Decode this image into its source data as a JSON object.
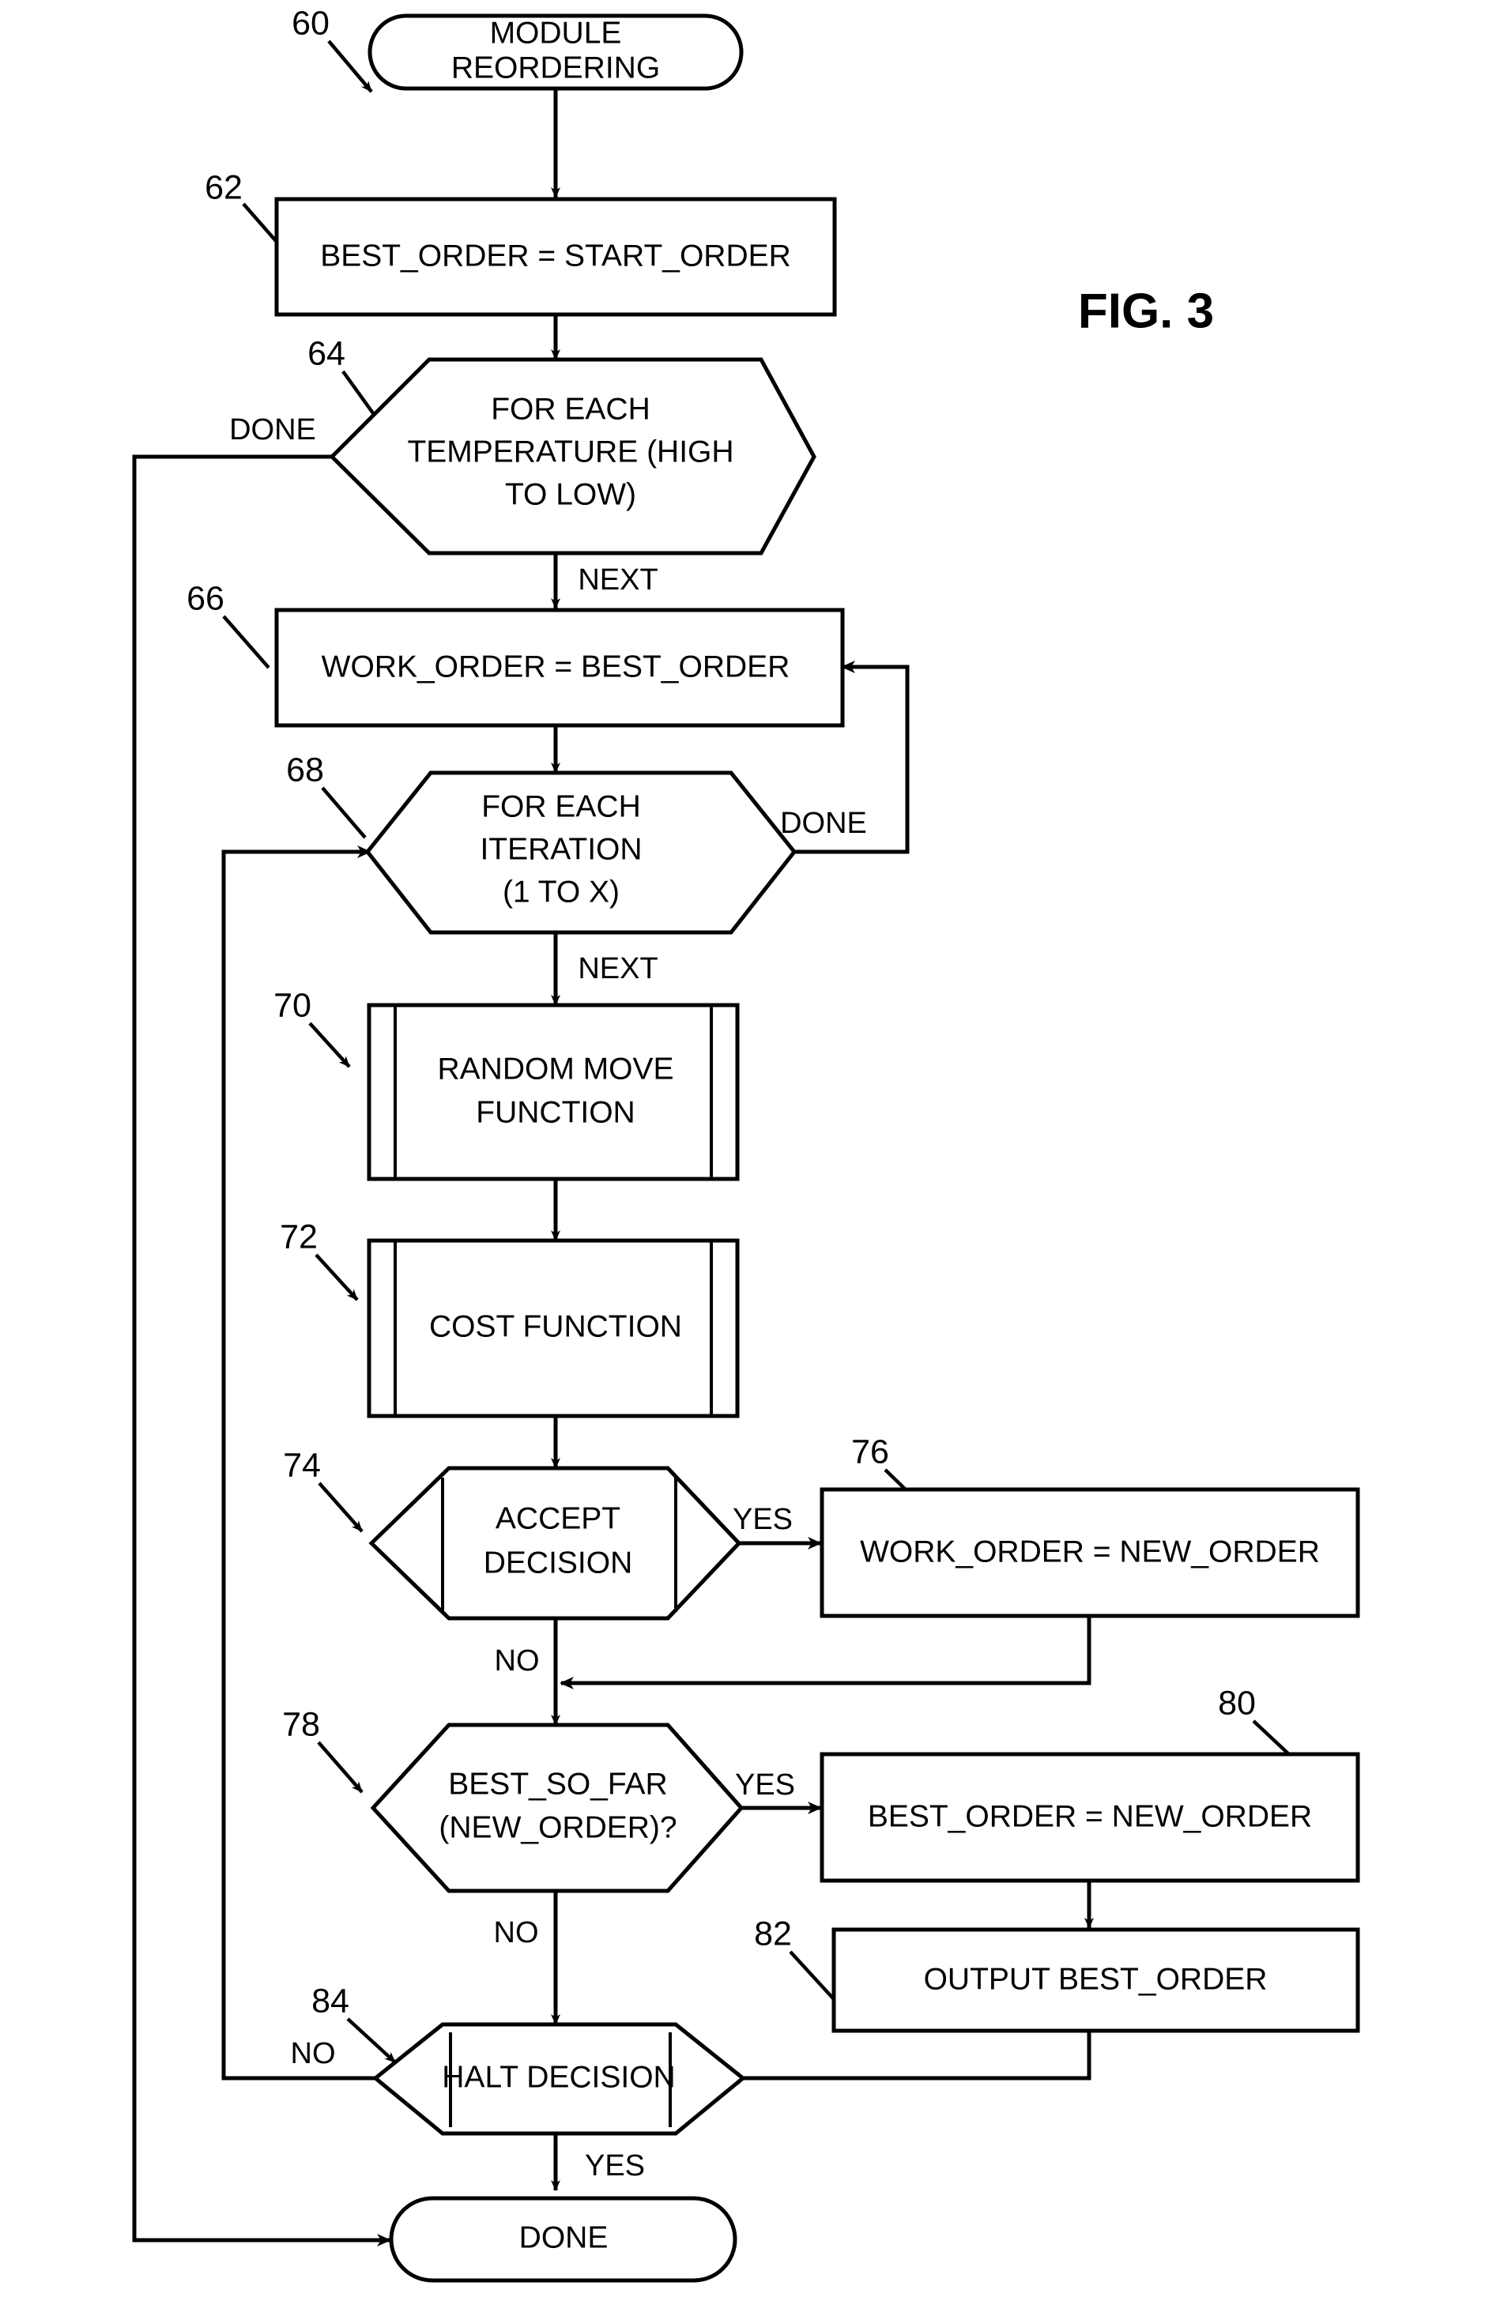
{
  "figure": {
    "label": "FIG. 3",
    "title": "MODULE REORDERING"
  },
  "nodes": [
    {
      "id": "n60",
      "ref": "60",
      "shape": "terminator",
      "lines": [
        "MODULE",
        "REORDERING"
      ]
    },
    {
      "id": "n62",
      "ref": "62",
      "shape": "process",
      "lines": [
        "BEST_ORDER = START_ORDER"
      ]
    },
    {
      "id": "n64",
      "ref": "64",
      "shape": "hexagon",
      "lines": [
        "FOR EACH",
        "TEMPERATURE (HIGH",
        "TO LOW)"
      ]
    },
    {
      "id": "n66",
      "ref": "66",
      "shape": "process",
      "lines": [
        "WORK_ORDER = BEST_ORDER"
      ]
    },
    {
      "id": "n68",
      "ref": "68",
      "shape": "hexagon",
      "lines": [
        "FOR EACH",
        "ITERATION",
        "(1 TO X)"
      ]
    },
    {
      "id": "n70",
      "ref": "70",
      "shape": "subroutine",
      "lines": [
        "RANDOM MOVE",
        "FUNCTION"
      ]
    },
    {
      "id": "n72",
      "ref": "72",
      "shape": "subroutine",
      "lines": [
        "COST FUNCTION"
      ]
    },
    {
      "id": "n74",
      "ref": "74",
      "shape": "hexagon-bars",
      "lines": [
        "ACCEPT",
        "DECISION"
      ]
    },
    {
      "id": "n76",
      "ref": "76",
      "shape": "process",
      "lines": [
        "WORK_ORDER = NEW_ORDER"
      ]
    },
    {
      "id": "n78",
      "ref": "78",
      "shape": "hexagon",
      "lines": [
        "BEST_SO_FAR",
        "(NEW_ORDER)?"
      ]
    },
    {
      "id": "n80",
      "ref": "80",
      "shape": "process",
      "lines": [
        "BEST_ORDER = NEW_ORDER"
      ]
    },
    {
      "id": "n82",
      "ref": "82",
      "shape": "process",
      "lines": [
        "OUTPUT BEST_ORDER"
      ]
    },
    {
      "id": "n84",
      "ref": "84",
      "shape": "hexagon-bars",
      "lines": [
        "HALT DECISION"
      ]
    },
    {
      "id": "n86",
      "ref": "",
      "shape": "terminator",
      "lines": [
        "DONE"
      ]
    }
  ],
  "edge_labels": {
    "temp_done": "DONE",
    "temp_next": "NEXT",
    "iter_done": "DONE",
    "iter_next": "NEXT",
    "accept_yes": "YES",
    "accept_no": "NO",
    "best_yes": "YES",
    "best_no": "NO",
    "halt_no": "NO",
    "halt_yes": "YES"
  },
  "colors": {
    "stroke": "#000000",
    "fill": "#ffffff",
    "background": "#ffffff"
  }
}
